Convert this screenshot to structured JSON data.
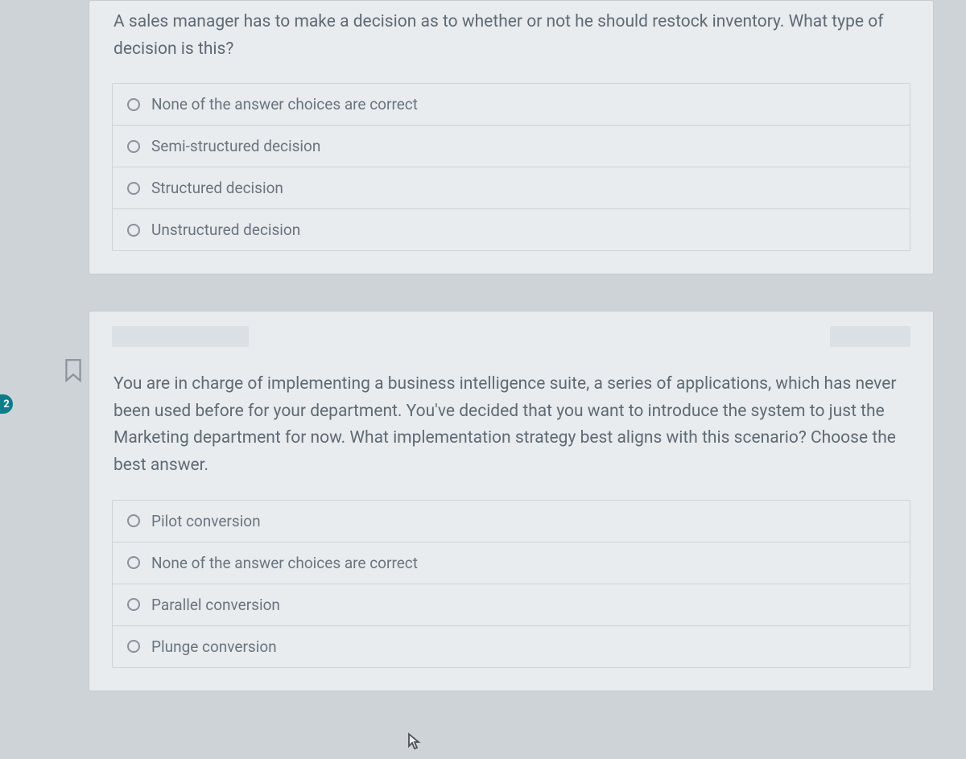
{
  "side_badge": "2",
  "questions": [
    {
      "prompt": "A sales manager has to make a decision as to whether or not he should restock inventory. What type of decision is this?",
      "choices": [
        "None of the answer choices are correct",
        "Semi-structured decision",
        "Structured decision",
        "Unstructured decision"
      ]
    },
    {
      "prompt": "You are in charge of implementing a business intelligence suite, a series of applications, which has never been used before for your department. You've decided that you want to introduce the system to just the Marketing department for now. What implementation strategy best aligns with this scenario? Choose the best answer.",
      "choices": [
        "Pilot conversion",
        "None of the answer choices are correct",
        "Parallel conversion",
        "Plunge conversion"
      ]
    }
  ]
}
